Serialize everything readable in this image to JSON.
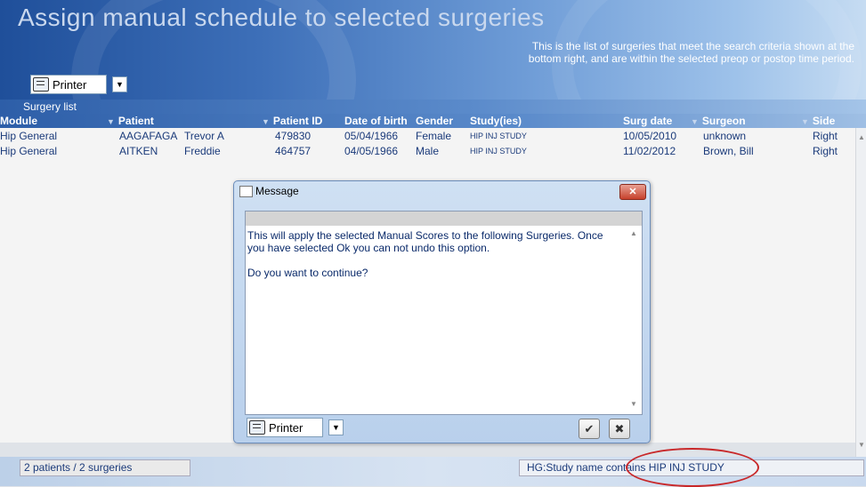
{
  "header": {
    "title": "Assign manual schedule to selected surgeries",
    "info_text": "This is the list of surgeries that meet the search criteria shown at the bottom right, and are within the selected preop or postop time period.",
    "printer_label": "Printer"
  },
  "panel": {
    "title": "Surgery list"
  },
  "columns": {
    "module": "Module",
    "patient": "Patient",
    "patient_id": "Patient ID",
    "dob": "Date of birth",
    "gender": "Gender",
    "studies": "Study(ies)",
    "surg_date": "Surg date",
    "surgeon": "Surgeon",
    "side": "Side"
  },
  "rows": [
    {
      "module": "Hip General",
      "surname": "AAGAFAGA",
      "firstname": "Trevor A",
      "patient_id": "479830",
      "dob": "05/04/1966",
      "gender": "Female",
      "study": "HIP INJ STUDY",
      "surg_date": "10/05/2010",
      "surgeon": "unknown",
      "side": "Right"
    },
    {
      "module": "Hip General",
      "surname": "AITKEN",
      "firstname": "Freddie",
      "patient_id": "464757",
      "dob": "04/05/1966",
      "gender": "Male",
      "study": "HIP INJ STUDY",
      "surg_date": "11/02/2012",
      "surgeon": "Brown, Bill",
      "side": "Right"
    }
  ],
  "footer": {
    "count": "2 patients / 2 surgeries",
    "criteria": "HG:Study name  contains  HIP INJ STUDY"
  },
  "dialog": {
    "title": "Message",
    "message": "This will apply the selected Manual Scores to the following Surgeries. Once you have selected Ok you can not undo this option.",
    "question": "Do you want to continue?",
    "printer_label": "Printer",
    "close_glyph": "✕",
    "ok_glyph": "✔",
    "cancel_glyph": "✖"
  },
  "colors": {
    "annotation_circle": "#c8282a",
    "header_blue": "#2d5ea8"
  }
}
